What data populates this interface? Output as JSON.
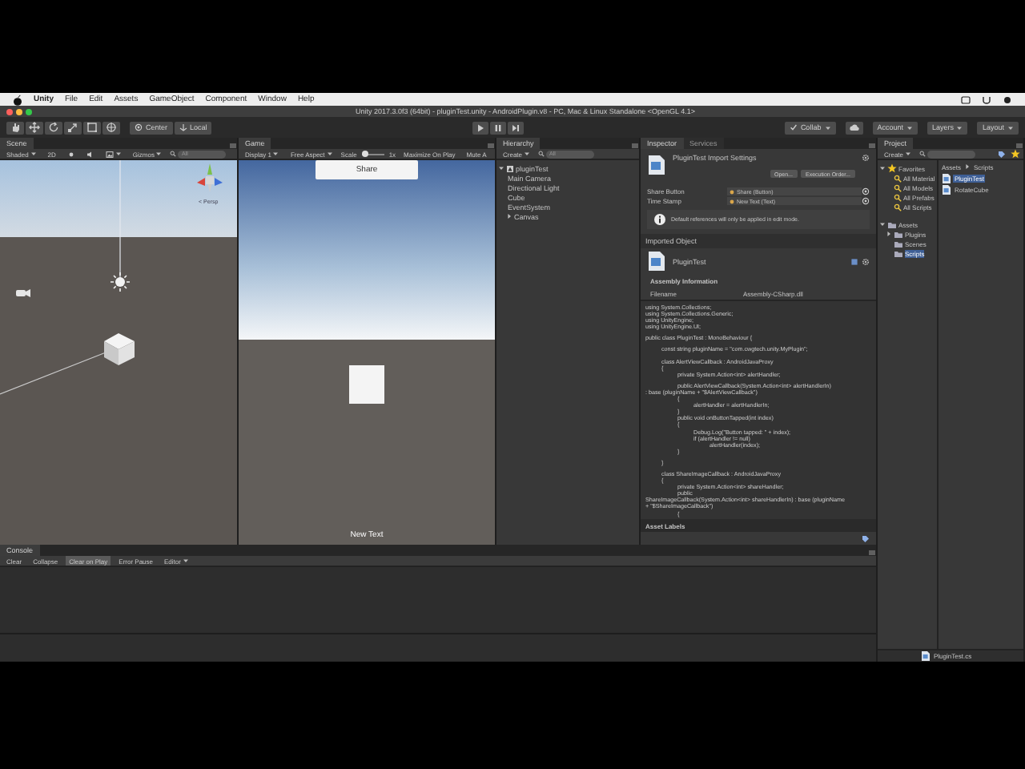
{
  "menubar": {
    "items": [
      "Unity",
      "File",
      "Edit",
      "Assets",
      "GameObject",
      "Component",
      "Window",
      "Help"
    ]
  },
  "window": {
    "title": "Unity 2017.3.0f3 (64bit) - pluginTest.unity - AndroidPlugin.v8 - PC, Mac & Linux Standalone <OpenGL 4.1>"
  },
  "toolbar": {
    "pivot": "Center",
    "space": "Local",
    "right": [
      "Collab",
      "Account",
      "Layers",
      "Layout"
    ]
  },
  "scene": {
    "tab": "Scene",
    "toolbar": {
      "shading": "Shaded",
      "mode": "2D",
      "gizmos": "Gizmos",
      "search_placeholder": "All"
    },
    "gizmo_label": "< Persp"
  },
  "game": {
    "tab": "Game",
    "toolbar": {
      "display": "Display 1",
      "aspect": "Free Aspect",
      "scale_label": "Scale",
      "scale_slider": {
        "level": 0.05
      },
      "scale_value": "1x",
      "maximize": "Maximize On Play",
      "mute": "Mute A"
    },
    "share_button": "Share",
    "status_text": "New Text"
  },
  "hierarchy": {
    "tab": "Hierarchy",
    "create": "Create",
    "search_placeholder": "All",
    "tree": [
      {
        "label": "pluginTest",
        "expanded": true,
        "children": [
          {
            "label": "Main Camera"
          },
          {
            "label": "Directional Light"
          },
          {
            "label": "Cube"
          },
          {
            "label": "EventSystem"
          },
          {
            "label": "Canvas",
            "expanded": false
          }
        ]
      }
    ]
  },
  "inspector": {
    "tabs": [
      {
        "label": "Inspector",
        "selected": true
      },
      {
        "label": "Services",
        "selected": false
      }
    ],
    "title": "PluginTest Import Settings",
    "buttons": [
      "Open...",
      "Execution Order..."
    ],
    "fields": [
      {
        "label": "Share Button",
        "value": "Share (Button)"
      },
      {
        "label": "Time Stamp",
        "value": "New Text (Text)"
      }
    ],
    "info": "Default references will only be applied in edit mode.",
    "imported_heading": "Imported Object",
    "object_name": "PluginTest",
    "assembly_heading": "Assembly Information",
    "filename": {
      "label": "Filename",
      "value": "Assembly-CSharp.dll"
    },
    "code_blocks": [
      [
        "using System.Collections;",
        "using System.Collections.Generic;",
        "using UnityEngine;",
        "using UnityEngine.UI;"
      ],
      [
        "public class PluginTest : MonoBehaviour {"
      ],
      [
        "\tconst string pluginName = \"com.cwgtech.unity.MyPlugin\";"
      ],
      [
        "\tclass AlertViewCallback : AndroidJavaProxy",
        "\t{",
        "\t\tprivate System.Action<int> alertHandler;"
      ],
      [
        "\t\tpublic AlertViewCallback(System.Action<int> alertHandlerIn)",
        ": base (pluginName + \"$AlertViewCallback\")",
        "\t\t{",
        "\t\t\talertHandler = alertHandlerIn;",
        "\t\t}",
        "\t\tpublic void onButtonTapped(int index)",
        "\t\t{",
        "\t\t\tDebug.Log(\"Button tapped: \" + index);",
        "\t\t\tif (alertHandler != null)",
        "\t\t\t\talertHandler(index);",
        "\t\t}"
      ],
      [
        "\t}"
      ],
      [
        "\tclass ShareImageCallback : AndroidJavaProxy",
        "\t{",
        "\t\tprivate System.Action<int> shareHandler;",
        "\t\tpublic",
        "ShareImageCallback(System.Action<int> shareHandlerIn) : base (pluginName",
        "+ \"$ShareImageCallback\")",
        "\t\t{"
      ]
    ],
    "asset_labels": "Asset Labels"
  },
  "project": {
    "tab": "Project",
    "create": "Create",
    "favorites": {
      "label": "Favorites",
      "expanded": true,
      "children": [
        {
          "label": "All Material"
        },
        {
          "label": "All Models"
        },
        {
          "label": "All Prefabs"
        },
        {
          "label": "All Scripts"
        }
      ]
    },
    "assets": {
      "label": "Assets",
      "expanded": true,
      "children": [
        {
          "label": "Plugins",
          "expanded": false,
          "selected": false
        },
        {
          "label": "Scenes",
          "selected": false
        },
        {
          "label": "Scripts",
          "selected": true
        }
      ]
    },
    "breadcrumb": [
      "Assets",
      "Scripts"
    ],
    "files": [
      {
        "label": "PluginTest",
        "selected": true
      },
      {
        "label": "RotateCube",
        "selected": false
      }
    ],
    "footer": "PluginTest.cs"
  },
  "console": {
    "tab": "Console",
    "buttons": [
      {
        "label": "Clear",
        "on": false,
        "dropdown": false
      },
      {
        "label": "Collapse",
        "on": false,
        "dropdown": false
      },
      {
        "label": "Clear on Play",
        "on": true,
        "dropdown": false
      },
      {
        "label": "Error Pause",
        "on": false,
        "dropdown": false
      },
      {
        "label": "Editor",
        "on": false,
        "dropdown": true
      }
    ]
  }
}
